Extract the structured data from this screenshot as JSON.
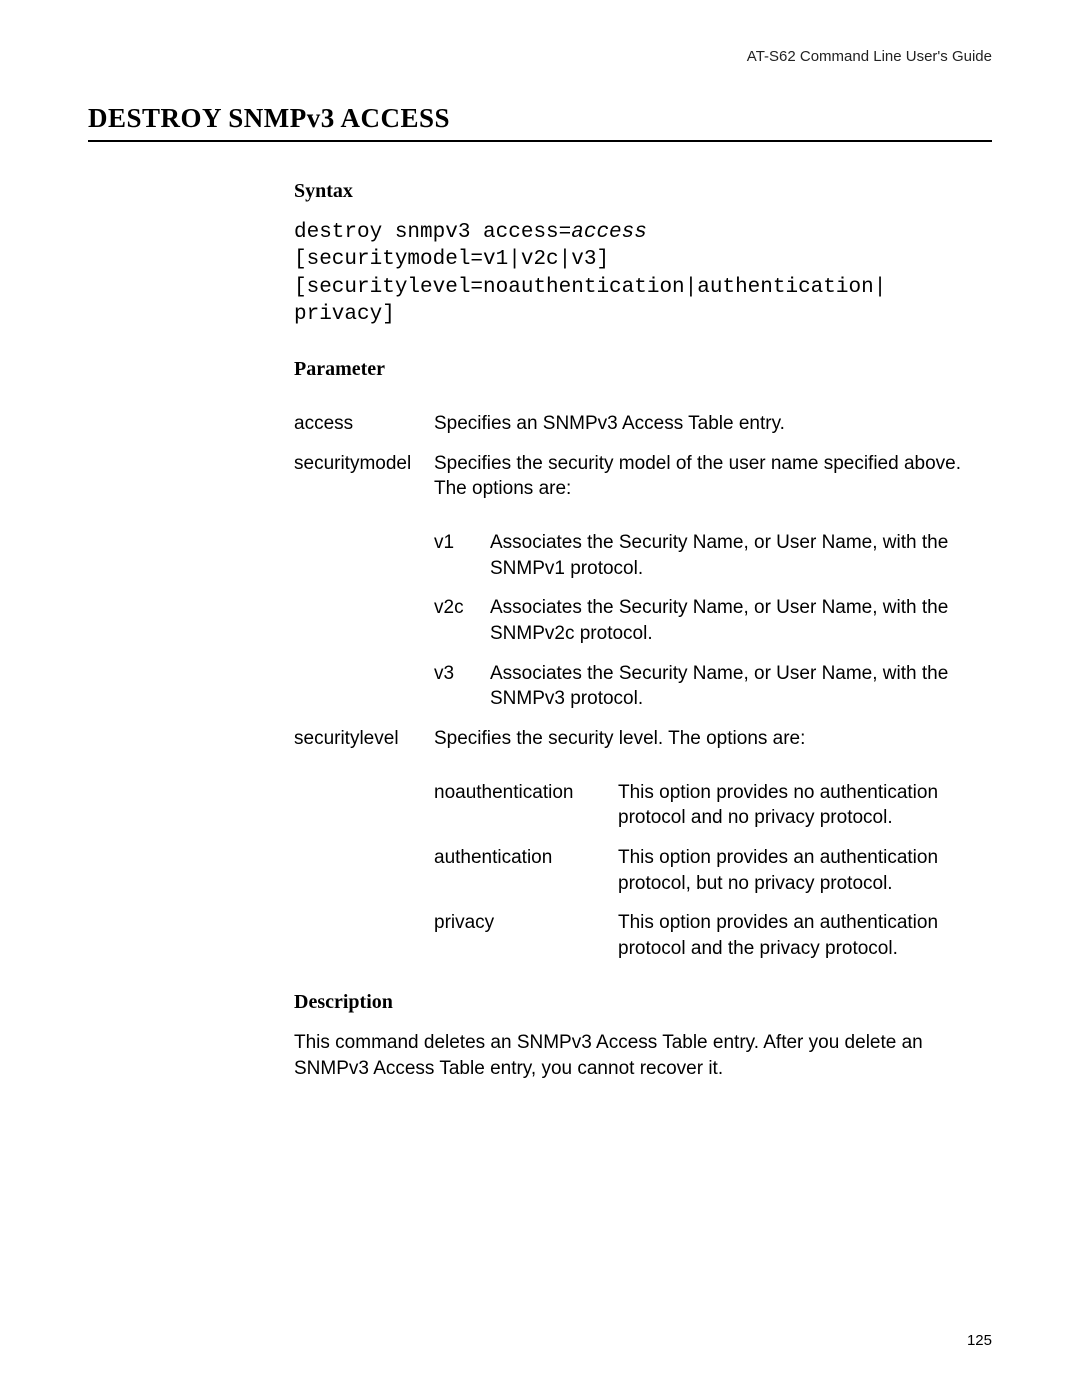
{
  "header": {
    "guide": "AT-S62 Command Line User's Guide"
  },
  "title": "DESTROY SNMPv3 ACCESS",
  "sections": {
    "syntax_heading": "Syntax",
    "parameter_heading": "Parameter",
    "description_heading": "Description"
  },
  "syntax": {
    "prefix": "destroy snmpv3 access=",
    "arg": "access",
    "rest": "\n[securitymodel=v1|v2c|v3]\n[securitylevel=noauthentication|authentication|\nprivacy]"
  },
  "parameters": [
    {
      "name": "access",
      "desc": "Specifies an SNMPv3 Access Table entry."
    },
    {
      "name": "securitymodel",
      "desc": "Specifies the security model of the user name specified above. The options are:",
      "options_style": "narrow",
      "options": [
        {
          "key": "v1",
          "desc": "Associates the Security Name, or User Name, with the SNMPv1 protocol."
        },
        {
          "key": "v2c",
          "desc": "Associates the Security Name, or User Name, with the SNMPv2c protocol."
        },
        {
          "key": "v3",
          "desc": "Associates the Security Name, or User Name, with the SNMPv3 protocol."
        }
      ]
    },
    {
      "name": "securitylevel",
      "desc": "Specifies the security level. The options are:",
      "options_style": "wide",
      "options": [
        {
          "key": "noauthentication",
          "desc": "This option provides no authentication protocol and no privacy protocol."
        },
        {
          "key": "authentication",
          "desc": "This option provides an authentication protocol, but no privacy protocol."
        },
        {
          "key": "privacy",
          "desc": "This option provides an authentication protocol and the privacy protocol."
        }
      ]
    }
  ],
  "description_text": "This command deletes an SNMPv3 Access Table entry. After you delete an SNMPv3 Access Table entry, you cannot recover it.",
  "page_number": "125"
}
